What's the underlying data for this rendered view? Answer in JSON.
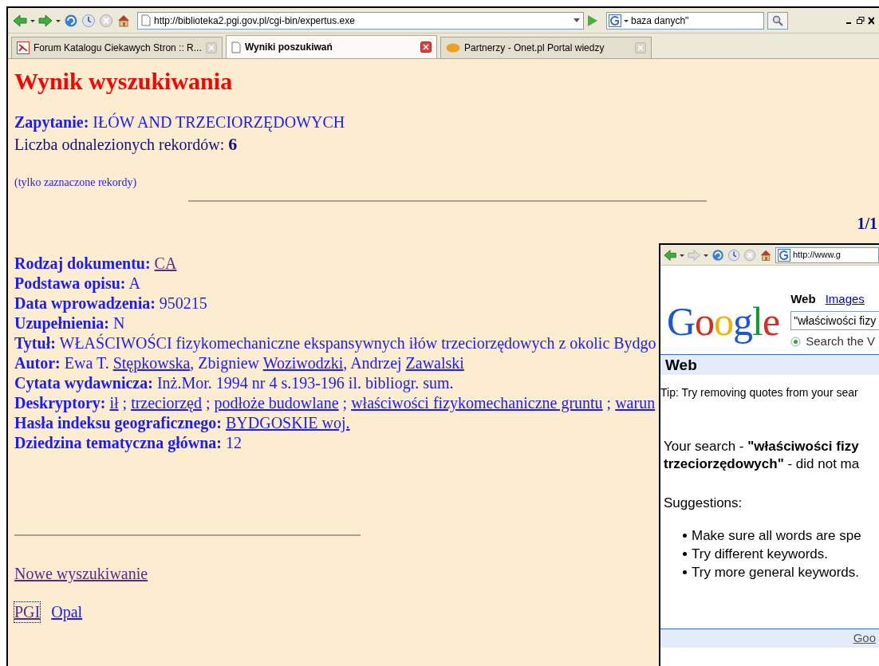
{
  "browser": {
    "url": "http://biblioteka2.pgi.gov.pl/cgi-bin/expertus.exe",
    "search_value": "baza danych\"",
    "tabs": [
      {
        "label": "Forum Katalogu Ciekawych Stron :: R...",
        "selected": false,
        "kind": "forum"
      },
      {
        "label": "Wyniki poszukiwań",
        "selected": true,
        "kind": "page"
      },
      {
        "label": "Partnerzy - Onet.pl Portal wiedzy",
        "selected": false,
        "kind": "onet"
      }
    ]
  },
  "page": {
    "title": "Wynik wyszukiwania",
    "query_label": "Zapytanie:",
    "query_value": "IŁÓW AND TRZECIORZĘDOWYCH",
    "count_label": "Liczba odnalezionych rekordów:",
    "count_value": "6",
    "note": "(tylko zaznaczone rekordy)",
    "pager": "1/1",
    "fields": [
      {
        "label": "Rodzaj dokumentu:",
        "parts": [
          {
            "kind": "link",
            "text": "CA",
            "visited": true
          }
        ]
      },
      {
        "label": "Podstawa opisu:",
        "parts": [
          {
            "kind": "text",
            "text": "A"
          }
        ]
      },
      {
        "label": "Data wprowadzenia:",
        "parts": [
          {
            "kind": "text",
            "text": "950215"
          }
        ]
      },
      {
        "label": "Uzupełnienia:",
        "parts": [
          {
            "kind": "text",
            "text": "N"
          }
        ]
      },
      {
        "label": "Tytuł:",
        "parts": [
          {
            "kind": "text",
            "text": "WŁAŚCIWOŚCI fizykomechaniczne ekspansywnych iłów trzeciorzędowych z okolic Bydgo"
          }
        ]
      },
      {
        "label": "Autor:",
        "parts": [
          {
            "kind": "text",
            "text": "Ewa T."
          },
          {
            "kind": "link",
            "text": "Stępkowska",
            "visited": false
          },
          {
            "kind": "cont",
            "text": ", Zbigniew"
          },
          {
            "kind": "link",
            "text": "Woziwodzki",
            "visited": false
          },
          {
            "kind": "cont",
            "text": ", Andrzej"
          },
          {
            "kind": "link",
            "text": "Zawalski",
            "visited": false
          }
        ]
      },
      {
        "label": "Cytata wydawnicza:",
        "parts": [
          {
            "kind": "text",
            "text": "Inż.Mor. 1994 nr 4 s.193-196 il. bibliogr. sum."
          }
        ]
      },
      {
        "label": "Deskryptory:",
        "parts": [
          {
            "kind": "link",
            "text": "ił",
            "visited": false
          },
          {
            "kind": "sep",
            "text": ";"
          },
          {
            "kind": "link",
            "text": "trzeciorzęd",
            "visited": false
          },
          {
            "kind": "sep",
            "text": ";"
          },
          {
            "kind": "link",
            "text": "podłoże budowlane",
            "visited": false
          },
          {
            "kind": "sep",
            "text": ";"
          },
          {
            "kind": "link",
            "text": "właściwości fizykomechaniczne gruntu",
            "visited": false
          },
          {
            "kind": "sep",
            "text": ";"
          },
          {
            "kind": "link",
            "text": "warun",
            "visited": false
          }
        ]
      },
      {
        "label": "Hasła indeksu geograficznego:",
        "parts": [
          {
            "kind": "link",
            "text": "BYDGOSKIE woj.",
            "visited": false
          }
        ]
      },
      {
        "label": "Dziedzina tematyczna główna:",
        "parts": [
          {
            "kind": "text",
            "text": "12"
          }
        ]
      }
    ],
    "new_search": {
      "text": "Nowe wyszukiwanie",
      "visited": true
    },
    "footer_links": [
      {
        "text": "PGI",
        "visited": true,
        "focused": true
      },
      {
        "text": "Opal",
        "visited": false,
        "focused": false
      }
    ]
  },
  "google_window": {
    "url": "http://www.g",
    "logo": "Google",
    "nav": [
      {
        "label": "Web",
        "selected": true
      },
      {
        "label": "Images",
        "selected": false
      }
    ],
    "search_value": "\"właściwości fizy",
    "radio": {
      "label": "Search the V",
      "checked": true
    },
    "section_title": "Web",
    "tip": "Tip: Try removing quotes from your sear",
    "message_lines": [
      "Your search - **\"właściwości fizy**",
      "**trzeciorzędowych\"** - did not ma"
    ],
    "suggestions_label": "Suggestions:",
    "suggestions": [
      "Make sure all words are spe",
      "Try different keywords.",
      "Try more general keywords."
    ],
    "footer_link": "Goo"
  }
}
